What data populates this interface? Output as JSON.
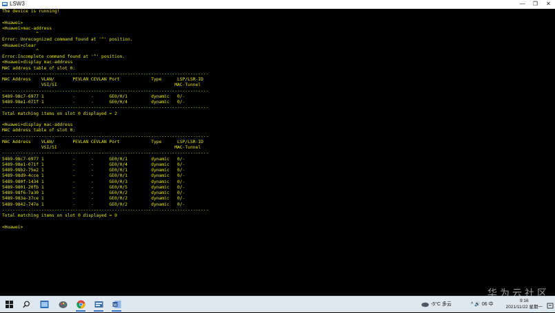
{
  "window": {
    "title": "LSW3",
    "minimize": "—",
    "restore": "❐",
    "close": "✕"
  },
  "terminal": {
    "lines": [
      "The device is running!",
      "",
      "<Huawei>",
      "<Huawei>mac-address",
      "             ^",
      "Error: Unrecognized command found at '^' position.",
      "<Huawei>clear",
      "             ^",
      "Error:Incomplete command found at '^' position.",
      "<Huawei>display mac-address",
      "MAC address table of slot 0:",
      "-------------------------------------------------------------------------------",
      "MAC Address    VLAN/       PEVLAN CEVLAN Port            Type      LSP/LSR-ID",
      "               VSI/SI                                             MAC-Tunnel",
      "-------------------------------------------------------------------------------",
      "5489-98c7-6977 1           -      -      GE0/0/1         dynamic   0/-",
      "5489-98e1-071f 1           -      -      GE0/0/4         dynamic   0/-",
      "-------------------------------------------------------------------------------",
      "Total matching items on slot 0 displayed = 2",
      "",
      "<Huawei>display mac-address",
      "MAC address table of slot 0:",
      "-------------------------------------------------------------------------------",
      "MAC Address    VLAN/       PEVLAN CEVLAN Port            Type      LSP/LSR-ID",
      "               VSI/SI                                             MAC-Tunnel",
      "-------------------------------------------------------------------------------",
      "5489-98c7-6977 1           -      -      GE0/0/1         dynamic   0/-",
      "5489-98e1-071f 1           -      -      GE0/0/4         dynamic   0/-",
      "5489-98b2-75e2 1           -      -      GE0/0/1         dynamic   0/-",
      "5489-98d9-4cce 1           -      -      GE0/0/1         dynamic   0/-",
      "5489-980f-1434 1           -      -      GE0/0/3         dynamic   0/-",
      "5489-9801-20fb 1           -      -      GE0/0/5         dynamic   0/-",
      "5489-98f6-7a30 1           -      -      GE0/0/2         dynamic   0/-",
      "5489-983a-37ce 1           -      -      GE0/0/2         dynamic   0/-",
      "5489-9842-747e 1           -      -      GE0/0/2         dynamic   0/-",
      "-------------------------------------------------------------------------------",
      "Total matching items on slot 0 displayed = 9",
      "",
      "<Huawei>"
    ],
    "text_color": "#e6e600",
    "background": "#000000"
  },
  "watermark": "华为云社区",
  "taskbar": {
    "pinned": [
      "start-icon",
      "search-icon",
      "network-tool-icon",
      "paint-icon",
      "chrome-icon",
      "ensp-icon",
      "word-icon"
    ],
    "weather": "-5°C 多云",
    "tray_text": "^ 🔊 06 中",
    "time": "9:16",
    "date": "2021/11/22 星期一"
  }
}
